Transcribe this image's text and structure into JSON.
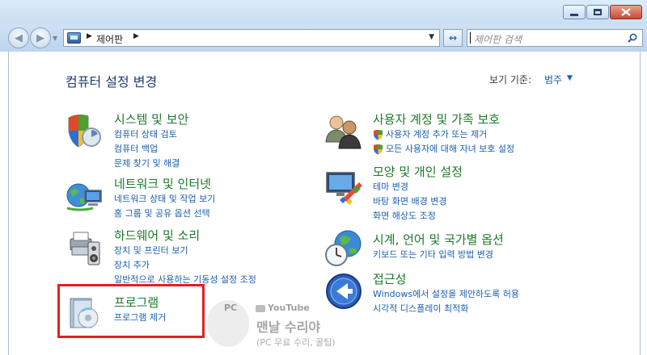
{
  "address_bar": {
    "path": "제어판"
  },
  "search": {
    "placeholder": "제어판 검색"
  },
  "header": {
    "title": "컴퓨터 설정 변경",
    "view_by_label": "보기 기준:",
    "view_by_value": "범주"
  },
  "categories": {
    "system": {
      "title": "시스템 및 보안",
      "links": [
        "컴퓨터 상태 검토",
        "컴퓨터 백업",
        "문제 찾기 및 해결"
      ]
    },
    "network": {
      "title": "네트워크 및 인터넷",
      "links": [
        "네트워크 상태 및 작업 보기",
        "홈 그룹 및 공유 옵션 선택"
      ]
    },
    "hardware": {
      "title": "하드웨어 및 소리",
      "links": [
        "장치 및 프린터 보기",
        "장치 추가",
        "일반적으로 사용하는 기동성 설정 조정"
      ]
    },
    "programs": {
      "title": "프로그램",
      "links": [
        "프로그램 제거"
      ]
    },
    "users": {
      "title": "사용자 계정 및 가족 보호",
      "links": [
        "사용자 계정 추가 또는 제거",
        "모든 사용자에 대해 자녀 보호 설정"
      ]
    },
    "appearance": {
      "title": "모양 및 개인 설정",
      "links": [
        "테마 변경",
        "바탕 화면 배경 변경",
        "화면 해상도 조정"
      ]
    },
    "clock": {
      "title": "시계, 언어 및 국가별 옵션",
      "links": [
        "키보드 또는 기타 입력 방법 변경"
      ]
    },
    "access": {
      "title": "접근성",
      "links": [
        "Windows에서 설정을 제안하도록 허용",
        "시각적 디스플레이 최적화"
      ]
    }
  },
  "watermark": {
    "pc": "PC",
    "youtube": "YouTube",
    "channel": "맨날 수리야",
    "subtitle": "(PC 무료 수리, 꿀팁)"
  },
  "colors": {
    "title_green": "#1d7a2a",
    "link_blue": "#1a5fb0",
    "highlight_red": "#e32020"
  }
}
